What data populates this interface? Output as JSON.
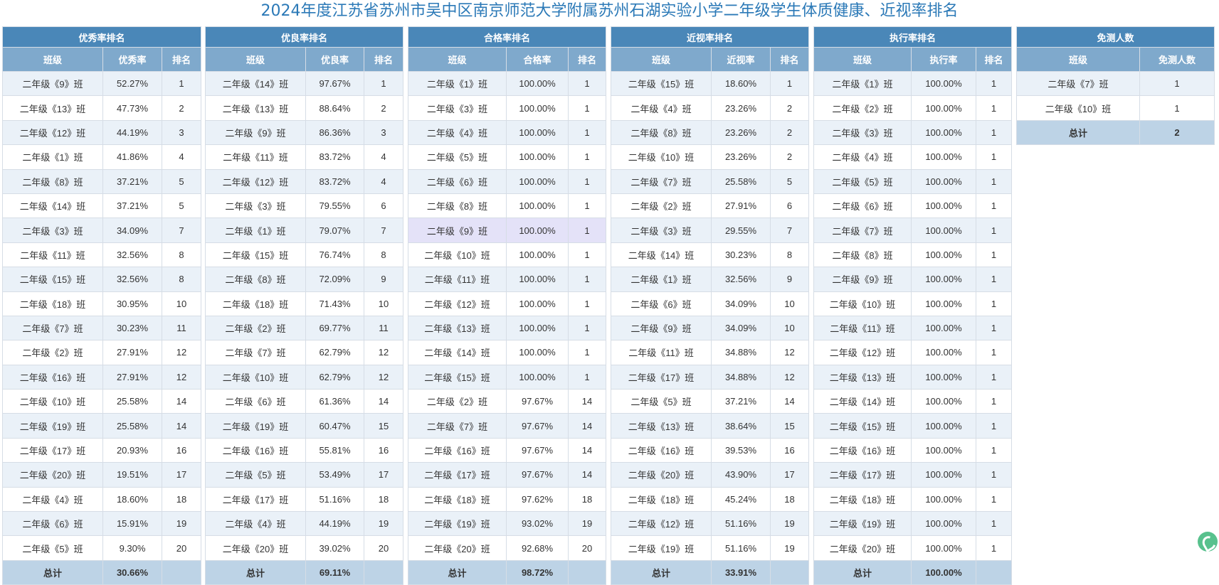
{
  "title": "2024年度江苏省苏州市吴中区南京师范大学附属苏州石湖实验小学二年级学生体质健康、近视率排名",
  "tables": [
    {
      "header": "优秀率排名",
      "columns": [
        "班级",
        "优秀率",
        "排名"
      ],
      "rows": [
        [
          "二年级《9》班",
          "52.27%",
          "1"
        ],
        [
          "二年级《13》班",
          "47.73%",
          "2"
        ],
        [
          "二年级《12》班",
          "44.19%",
          "3"
        ],
        [
          "二年级《1》班",
          "41.86%",
          "4"
        ],
        [
          "二年级《8》班",
          "37.21%",
          "5"
        ],
        [
          "二年级《14》班",
          "37.21%",
          "5"
        ],
        [
          "二年级《3》班",
          "34.09%",
          "7"
        ],
        [
          "二年级《11》班",
          "32.56%",
          "8"
        ],
        [
          "二年级《15》班",
          "32.56%",
          "8"
        ],
        [
          "二年级《18》班",
          "30.95%",
          "10"
        ],
        [
          "二年级《7》班",
          "30.23%",
          "11"
        ],
        [
          "二年级《2》班",
          "27.91%",
          "12"
        ],
        [
          "二年级《16》班",
          "27.91%",
          "12"
        ],
        [
          "二年级《10》班",
          "25.58%",
          "14"
        ],
        [
          "二年级《19》班",
          "25.58%",
          "14"
        ],
        [
          "二年级《17》班",
          "20.93%",
          "16"
        ],
        [
          "二年级《20》班",
          "19.51%",
          "17"
        ],
        [
          "二年级《4》班",
          "18.60%",
          "18"
        ],
        [
          "二年级《6》班",
          "15.91%",
          "19"
        ],
        [
          "二年级《5》班",
          "9.30%",
          "20"
        ]
      ],
      "total": [
        "总计",
        "30.66%",
        ""
      ]
    },
    {
      "header": "优良率排名",
      "columns": [
        "班级",
        "优良率",
        "排名"
      ],
      "rows": [
        [
          "二年级《14》班",
          "97.67%",
          "1"
        ],
        [
          "二年级《13》班",
          "88.64%",
          "2"
        ],
        [
          "二年级《9》班",
          "86.36%",
          "3"
        ],
        [
          "二年级《11》班",
          "83.72%",
          "4"
        ],
        [
          "二年级《12》班",
          "83.72%",
          "4"
        ],
        [
          "二年级《3》班",
          "79.55%",
          "6"
        ],
        [
          "二年级《1》班",
          "79.07%",
          "7"
        ],
        [
          "二年级《15》班",
          "76.74%",
          "8"
        ],
        [
          "二年级《8》班",
          "72.09%",
          "9"
        ],
        [
          "二年级《18》班",
          "71.43%",
          "10"
        ],
        [
          "二年级《2》班",
          "69.77%",
          "11"
        ],
        [
          "二年级《7》班",
          "62.79%",
          "12"
        ],
        [
          "二年级《10》班",
          "62.79%",
          "12"
        ],
        [
          "二年级《6》班",
          "61.36%",
          "14"
        ],
        [
          "二年级《19》班",
          "60.47%",
          "15"
        ],
        [
          "二年级《16》班",
          "55.81%",
          "16"
        ],
        [
          "二年级《5》班",
          "53.49%",
          "17"
        ],
        [
          "二年级《17》班",
          "51.16%",
          "18"
        ],
        [
          "二年级《4》班",
          "44.19%",
          "19"
        ],
        [
          "二年级《20》班",
          "39.02%",
          "20"
        ]
      ],
      "total": [
        "总计",
        "69.11%",
        ""
      ]
    },
    {
      "header": "合格率排名",
      "columns": [
        "班级",
        "合格率",
        "排名"
      ],
      "rows": [
        [
          "二年级《1》班",
          "100.00%",
          "1"
        ],
        [
          "二年级《3》班",
          "100.00%",
          "1"
        ],
        [
          "二年级《4》班",
          "100.00%",
          "1"
        ],
        [
          "二年级《5》班",
          "100.00%",
          "1"
        ],
        [
          "二年级《6》班",
          "100.00%",
          "1"
        ],
        [
          "二年级《8》班",
          "100.00%",
          "1"
        ],
        [
          "二年级《9》班",
          "100.00%",
          "1"
        ],
        [
          "二年级《10》班",
          "100.00%",
          "1"
        ],
        [
          "二年级《11》班",
          "100.00%",
          "1"
        ],
        [
          "二年级《12》班",
          "100.00%",
          "1"
        ],
        [
          "二年级《13》班",
          "100.00%",
          "1"
        ],
        [
          "二年级《14》班",
          "100.00%",
          "1"
        ],
        [
          "二年级《15》班",
          "100.00%",
          "1"
        ],
        [
          "二年级《2》班",
          "97.67%",
          "14"
        ],
        [
          "二年级《7》班",
          "97.67%",
          "14"
        ],
        [
          "二年级《16》班",
          "97.67%",
          "14"
        ],
        [
          "二年级《17》班",
          "97.67%",
          "14"
        ],
        [
          "二年级《18》班",
          "97.62%",
          "18"
        ],
        [
          "二年级《19》班",
          "93.02%",
          "19"
        ],
        [
          "二年级《20》班",
          "92.68%",
          "20"
        ]
      ],
      "total": [
        "总计",
        "98.72%",
        ""
      ],
      "highlight_row": 6
    },
    {
      "header": "近视率排名",
      "columns": [
        "班级",
        "近视率",
        "排名"
      ],
      "rows": [
        [
          "二年级《15》班",
          "18.60%",
          "1"
        ],
        [
          "二年级《4》班",
          "23.26%",
          "2"
        ],
        [
          "二年级《8》班",
          "23.26%",
          "2"
        ],
        [
          "二年级《10》班",
          "23.26%",
          "2"
        ],
        [
          "二年级《7》班",
          "25.58%",
          "5"
        ],
        [
          "二年级《2》班",
          "27.91%",
          "6"
        ],
        [
          "二年级《3》班",
          "29.55%",
          "7"
        ],
        [
          "二年级《14》班",
          "30.23%",
          "8"
        ],
        [
          "二年级《1》班",
          "32.56%",
          "9"
        ],
        [
          "二年级《6》班",
          "34.09%",
          "10"
        ],
        [
          "二年级《9》班",
          "34.09%",
          "10"
        ],
        [
          "二年级《11》班",
          "34.88%",
          "12"
        ],
        [
          "二年级《17》班",
          "34.88%",
          "12"
        ],
        [
          "二年级《5》班",
          "37.21%",
          "14"
        ],
        [
          "二年级《13》班",
          "38.64%",
          "15"
        ],
        [
          "二年级《16》班",
          "39.53%",
          "16"
        ],
        [
          "二年级《20》班",
          "43.90%",
          "17"
        ],
        [
          "二年级《18》班",
          "45.24%",
          "18"
        ],
        [
          "二年级《12》班",
          "51.16%",
          "19"
        ],
        [
          "二年级《19》班",
          "51.16%",
          "19"
        ]
      ],
      "total": [
        "总计",
        "33.91%",
        ""
      ]
    },
    {
      "header": "执行率排名",
      "columns": [
        "班级",
        "执行率",
        "排名"
      ],
      "rows": [
        [
          "二年级《1》班",
          "100.00%",
          "1"
        ],
        [
          "二年级《2》班",
          "100.00%",
          "1"
        ],
        [
          "二年级《3》班",
          "100.00%",
          "1"
        ],
        [
          "二年级《4》班",
          "100.00%",
          "1"
        ],
        [
          "二年级《5》班",
          "100.00%",
          "1"
        ],
        [
          "二年级《6》班",
          "100.00%",
          "1"
        ],
        [
          "二年级《7》班",
          "100.00%",
          "1"
        ],
        [
          "二年级《8》班",
          "100.00%",
          "1"
        ],
        [
          "二年级《9》班",
          "100.00%",
          "1"
        ],
        [
          "二年级《10》班",
          "100.00%",
          "1"
        ],
        [
          "二年级《11》班",
          "100.00%",
          "1"
        ],
        [
          "二年级《12》班",
          "100.00%",
          "1"
        ],
        [
          "二年级《13》班",
          "100.00%",
          "1"
        ],
        [
          "二年级《14》班",
          "100.00%",
          "1"
        ],
        [
          "二年级《15》班",
          "100.00%",
          "1"
        ],
        [
          "二年级《16》班",
          "100.00%",
          "1"
        ],
        [
          "二年级《17》班",
          "100.00%",
          "1"
        ],
        [
          "二年级《18》班",
          "100.00%",
          "1"
        ],
        [
          "二年级《19》班",
          "100.00%",
          "1"
        ],
        [
          "二年级《20》班",
          "100.00%",
          "1"
        ]
      ],
      "total": [
        "总计",
        "100.00%",
        ""
      ]
    },
    {
      "header": "免测人数",
      "columns": [
        "班级",
        "免测人数"
      ],
      "rows": [
        [
          "二年级《7》班",
          "1"
        ],
        [
          "二年级《10》班",
          "1"
        ]
      ],
      "total": [
        "总计",
        "2"
      ]
    }
  ],
  "icons": {
    "floating_widget": "green-leaf-icon"
  }
}
